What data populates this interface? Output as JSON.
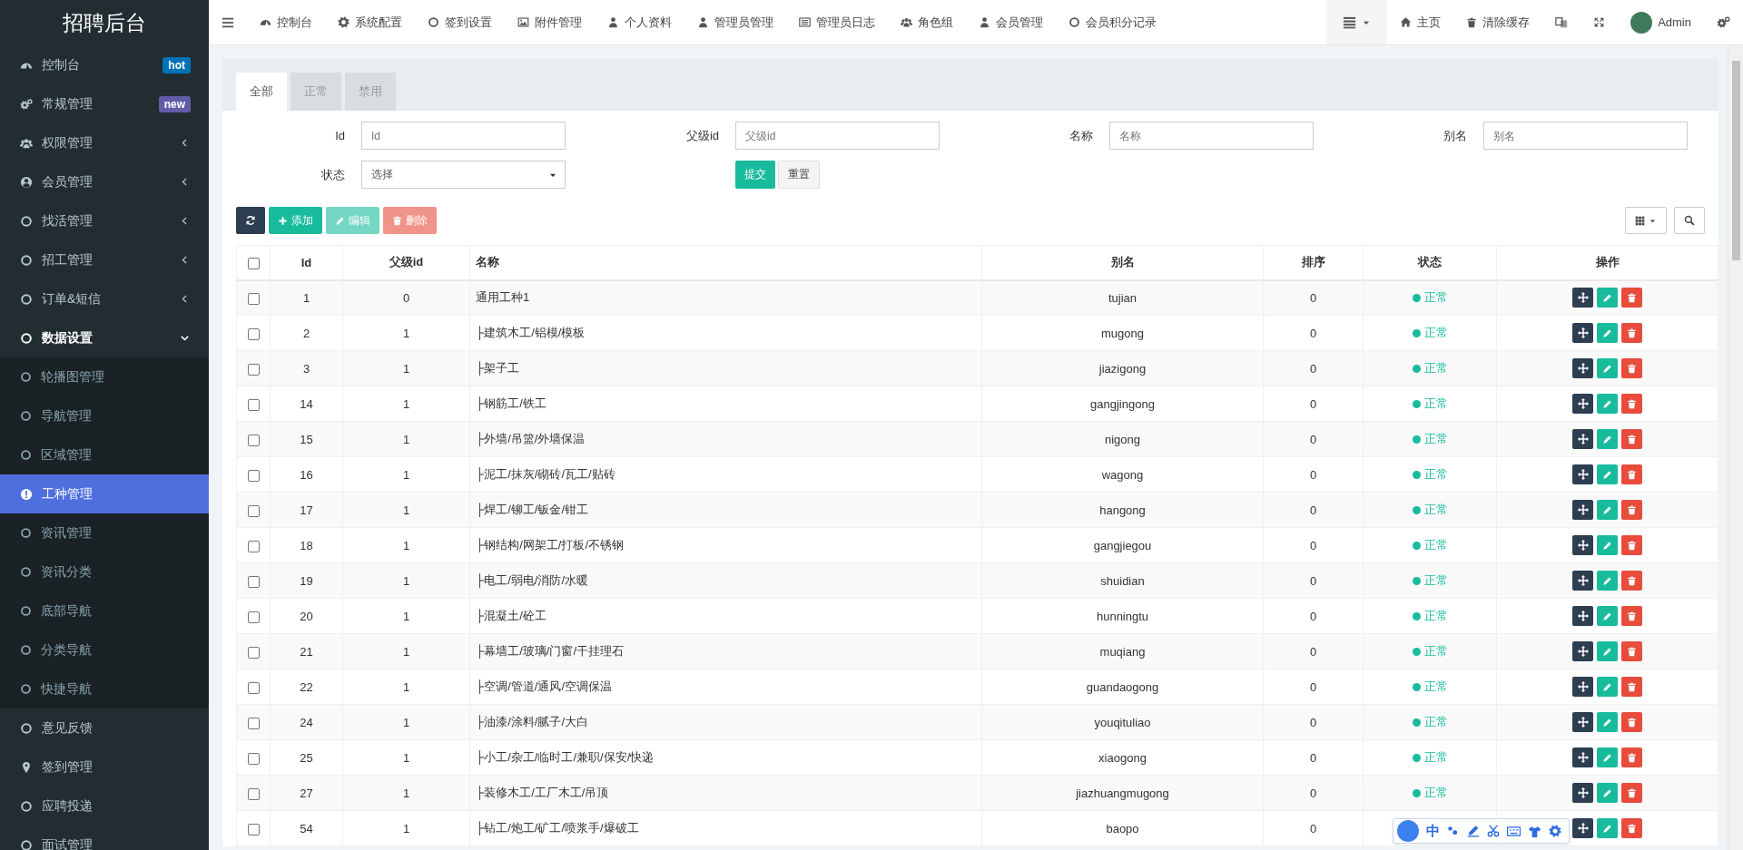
{
  "sidebar": {
    "title": "招聘后台",
    "items": [
      {
        "label": "控制台",
        "kind": "link",
        "selected": false,
        "badge": {
          "text": "hot",
          "color": "#0073b7"
        }
      },
      {
        "label": "常规管理",
        "kind": "link",
        "selected": false,
        "badge": {
          "text": "new",
          "color": "#605ca8"
        }
      },
      {
        "label": "权限管理",
        "kind": "menu",
        "selected": false,
        "expanded": false
      },
      {
        "label": "会员管理",
        "kind": "menu",
        "selected": false,
        "expanded": false
      },
      {
        "label": "找活管理",
        "kind": "menu",
        "selected": false,
        "expanded": false
      },
      {
        "label": "招工管理",
        "kind": "menu",
        "selected": false,
        "expanded": false
      },
      {
        "label": "订单&短信",
        "kind": "menu",
        "selected": false,
        "expanded": false
      },
      {
        "label": "数据设置",
        "kind": "menu",
        "selected": false,
        "expanded": true,
        "children": [
          {
            "label": "轮播图管理",
            "selected": false
          },
          {
            "label": "导航管理",
            "selected": false
          },
          {
            "label": "区域管理",
            "selected": false
          },
          {
            "label": "工种管理",
            "selected": true
          },
          {
            "label": "资讯管理",
            "selected": false
          },
          {
            "label": "资讯分类",
            "selected": false
          },
          {
            "label": "底部导航",
            "selected": false
          },
          {
            "label": "分类导航",
            "selected": false
          },
          {
            "label": "快捷导航",
            "selected": false
          }
        ]
      },
      {
        "label": "意见反馈",
        "kind": "link",
        "selected": false
      },
      {
        "label": "签到管理",
        "kind": "link",
        "selected": false
      },
      {
        "label": "应聘投递",
        "kind": "link",
        "selected": false
      },
      {
        "label": "面试管理",
        "kind": "link",
        "selected": false
      }
    ]
  },
  "top_nav": {
    "tabs": [
      "控制台",
      "系统配置",
      "签到设置",
      "附件管理",
      "个人资料",
      "管理员管理",
      "管理员日志",
      "角色组",
      "会员管理",
      "会员积分记录"
    ],
    "links": [
      "主页",
      "清除缓存"
    ],
    "user": "Admin"
  },
  "panel": {
    "tabs": [
      {
        "label": "全部",
        "selected": true
      },
      {
        "label": "正常",
        "selected": false
      },
      {
        "label": "禁用",
        "selected": false
      }
    ],
    "filters": [
      {
        "label": "Id",
        "placeholder": "Id"
      },
      {
        "label": "父级id",
        "placeholder": "父级id"
      },
      {
        "label": "名称",
        "placeholder": "名称"
      },
      {
        "label": "别名",
        "placeholder": "别名"
      }
    ],
    "status_filter": {
      "label": "状态",
      "value": "选择"
    },
    "submit": "提交",
    "reset": "重置",
    "toolbar": [
      {
        "kind": "refresh",
        "disabled": false
      },
      {
        "kind": "add",
        "label": "添加",
        "disabled": false
      },
      {
        "kind": "edit",
        "label": "编辑",
        "disabled": true
      },
      {
        "kind": "delete",
        "label": "删除",
        "disabled": true
      }
    ],
    "table": {
      "select_all": false,
      "columns": [
        "Id",
        "父级id",
        "名称",
        "别名",
        "排序",
        "状态",
        "操作"
      ],
      "rows": [
        {
          "id": "1",
          "pid": "0",
          "name": "通用工种1",
          "alias": "tujian",
          "weigh": "0",
          "status": "正常",
          "checked": false
        },
        {
          "id": "2",
          "pid": "1",
          "name": "├建筑木工/铝模/模板",
          "alias": "mugong",
          "weigh": "0",
          "status": "正常",
          "checked": false
        },
        {
          "id": "3",
          "pid": "1",
          "name": "├架子工",
          "alias": "jiazigong",
          "weigh": "0",
          "status": "正常",
          "checked": false
        },
        {
          "id": "14",
          "pid": "1",
          "name": "├钢筋工/铁工",
          "alias": "gangjingong",
          "weigh": "0",
          "status": "正常",
          "checked": false
        },
        {
          "id": "15",
          "pid": "1",
          "name": "├外墙/吊篮/外墙保温",
          "alias": "nigong",
          "weigh": "0",
          "status": "正常",
          "checked": false
        },
        {
          "id": "16",
          "pid": "1",
          "name": "├泥工/抹灰/砌砖/瓦工/贴砖",
          "alias": "wagong",
          "weigh": "0",
          "status": "正常",
          "checked": false
        },
        {
          "id": "17",
          "pid": "1",
          "name": "├焊工/铆工/钣金/钳工",
          "alias": "hangong",
          "weigh": "0",
          "status": "正常",
          "checked": false
        },
        {
          "id": "18",
          "pid": "1",
          "name": "├钢结构/网架工/打板/不锈钢",
          "alias": "gangjiegou",
          "weigh": "0",
          "status": "正常",
          "checked": false
        },
        {
          "id": "19",
          "pid": "1",
          "name": "├电工/弱电/消防/水暖",
          "alias": "shuidian",
          "weigh": "0",
          "status": "正常",
          "checked": false
        },
        {
          "id": "20",
          "pid": "1",
          "name": "├混凝土/砼工",
          "alias": "hunningtu",
          "weigh": "0",
          "status": "正常",
          "checked": false
        },
        {
          "id": "21",
          "pid": "1",
          "name": "├幕墙工/玻璃/门窗/干挂理石",
          "alias": "muqiang",
          "weigh": "0",
          "status": "正常",
          "checked": false
        },
        {
          "id": "22",
          "pid": "1",
          "name": "├空调/管道/通风/空调保温",
          "alias": "guandaogong",
          "weigh": "0",
          "status": "正常",
          "checked": false
        },
        {
          "id": "24",
          "pid": "1",
          "name": "├油漆/涂料/腻子/大白",
          "alias": "youqituliao",
          "weigh": "0",
          "status": "正常",
          "checked": false
        },
        {
          "id": "25",
          "pid": "1",
          "name": "├小工/杂工/临时工/兼职/保安/快递",
          "alias": "xiaogong",
          "weigh": "0",
          "status": "正常",
          "checked": false
        },
        {
          "id": "27",
          "pid": "1",
          "name": "├装修木工/工厂木工/吊顶",
          "alias": "jiazhuangmugong",
          "weigh": "0",
          "status": "正常",
          "checked": false
        },
        {
          "id": "54",
          "pid": "1",
          "name": "├钻工/炮工/矿工/喷浆手/爆破工",
          "alias": "baopo",
          "weigh": "0",
          "checked": false
        }
      ]
    }
  },
  "ime_toolbar": {
    "mode": "中"
  }
}
